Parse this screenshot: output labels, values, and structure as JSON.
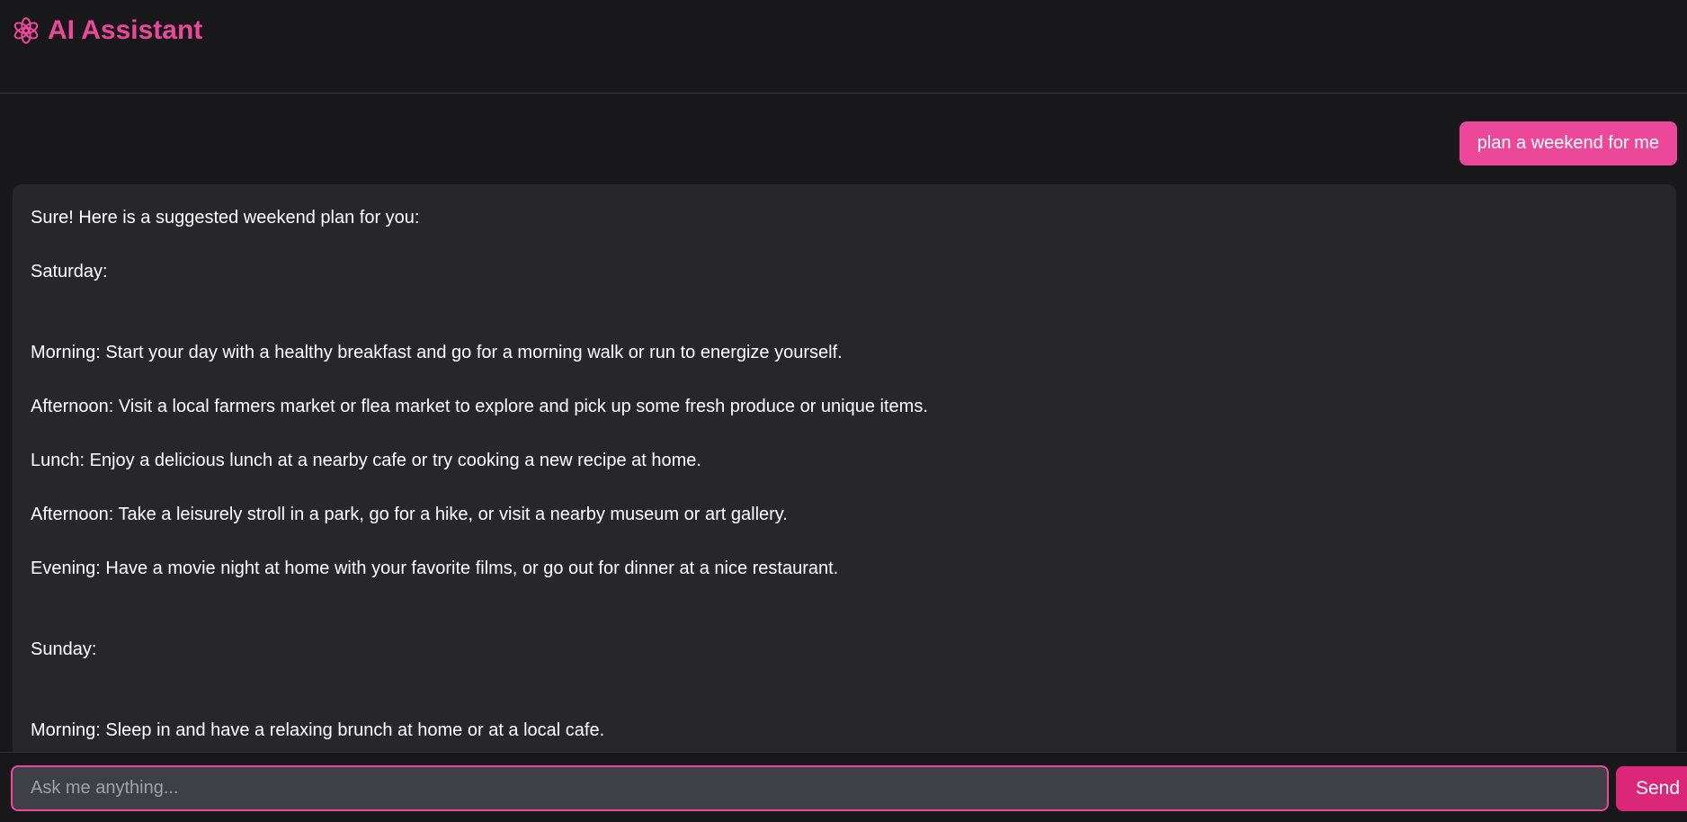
{
  "header": {
    "title": "AI Assistant",
    "logo_icon": "openai-logo-icon",
    "accent_color": "#ec4899"
  },
  "conversation": {
    "user_message": "plan a weekend for me",
    "assistant_message": {
      "intro": "Sure! Here is a suggested weekend plan for you:",
      "saturday_heading": "Saturday:",
      "saturday_items": [
        "Morning: Start your day with a healthy breakfast and go for a morning walk or run to energize yourself.",
        "Afternoon: Visit a local farmers market or flea market to explore and pick up some fresh produce or unique items.",
        "Lunch: Enjoy a delicious lunch at a nearby cafe or try cooking a new recipe at home.",
        "Afternoon: Take a leisurely stroll in a park, go for a hike, or visit a nearby museum or art gallery.",
        "Evening: Have a movie night at home with your favorite films, or go out for dinner at a nice restaurant."
      ],
      "sunday_heading": "Sunday:",
      "sunday_items": [
        "Morning: Sleep in and have a relaxing brunch at home or at a local cafe."
      ]
    }
  },
  "composer": {
    "placeholder": "Ask me anything...",
    "value": "",
    "send_label": "Send"
  }
}
